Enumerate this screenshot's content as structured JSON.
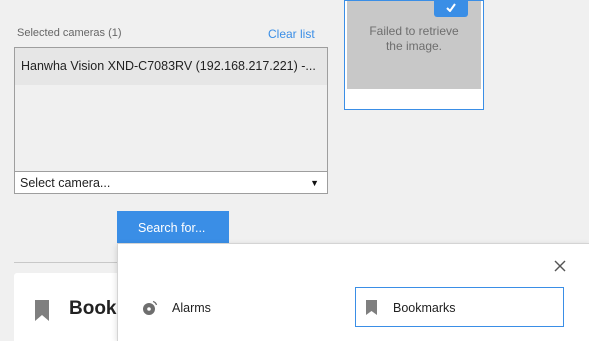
{
  "camera_selection": {
    "label": "Selected cameras (1)",
    "clear_label": "Clear list",
    "items": [
      "Hanwha Vision XND-C7083RV (192.168.217.221) -..."
    ],
    "select_placeholder": "Select camera..."
  },
  "thumbnail": {
    "error_text": "Failed to retrieve the image.",
    "badge_icon": "check-icon"
  },
  "search": {
    "button_label": "Search for..."
  },
  "background_card": {
    "title": "Bookmarks",
    "icon": "bookmark-icon"
  },
  "search_popup": {
    "close_icon": "close-icon",
    "options": [
      {
        "label": "Alarms",
        "icon": "alarm-icon",
        "selected": false
      },
      {
        "label": "Bookmarks",
        "icon": "bookmark-icon",
        "selected": true
      }
    ]
  },
  "colors": {
    "accent": "#3a8ee6",
    "background": "#f0f0f0",
    "thumbnail_gray": "#c8c8c8"
  }
}
